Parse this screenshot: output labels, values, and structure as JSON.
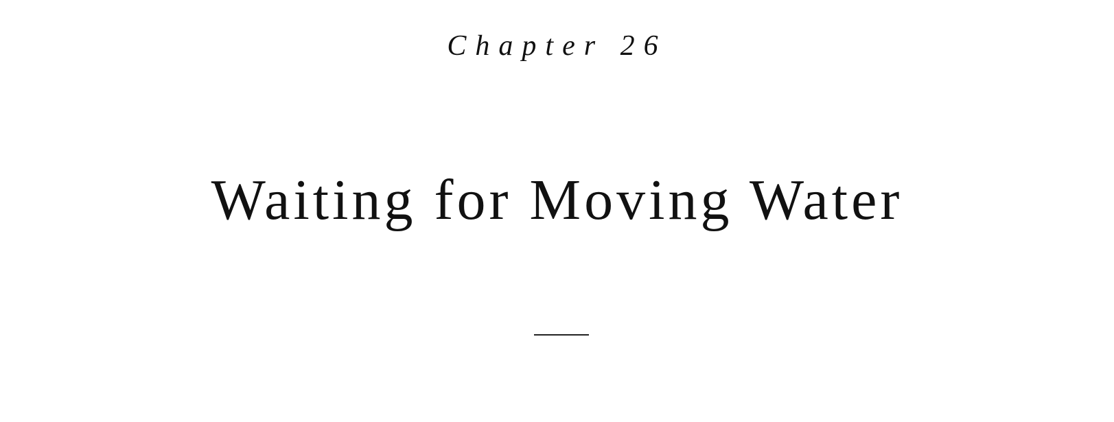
{
  "chapter": {
    "label": "Chapter 26",
    "title": "Waiting for Moving Water"
  }
}
